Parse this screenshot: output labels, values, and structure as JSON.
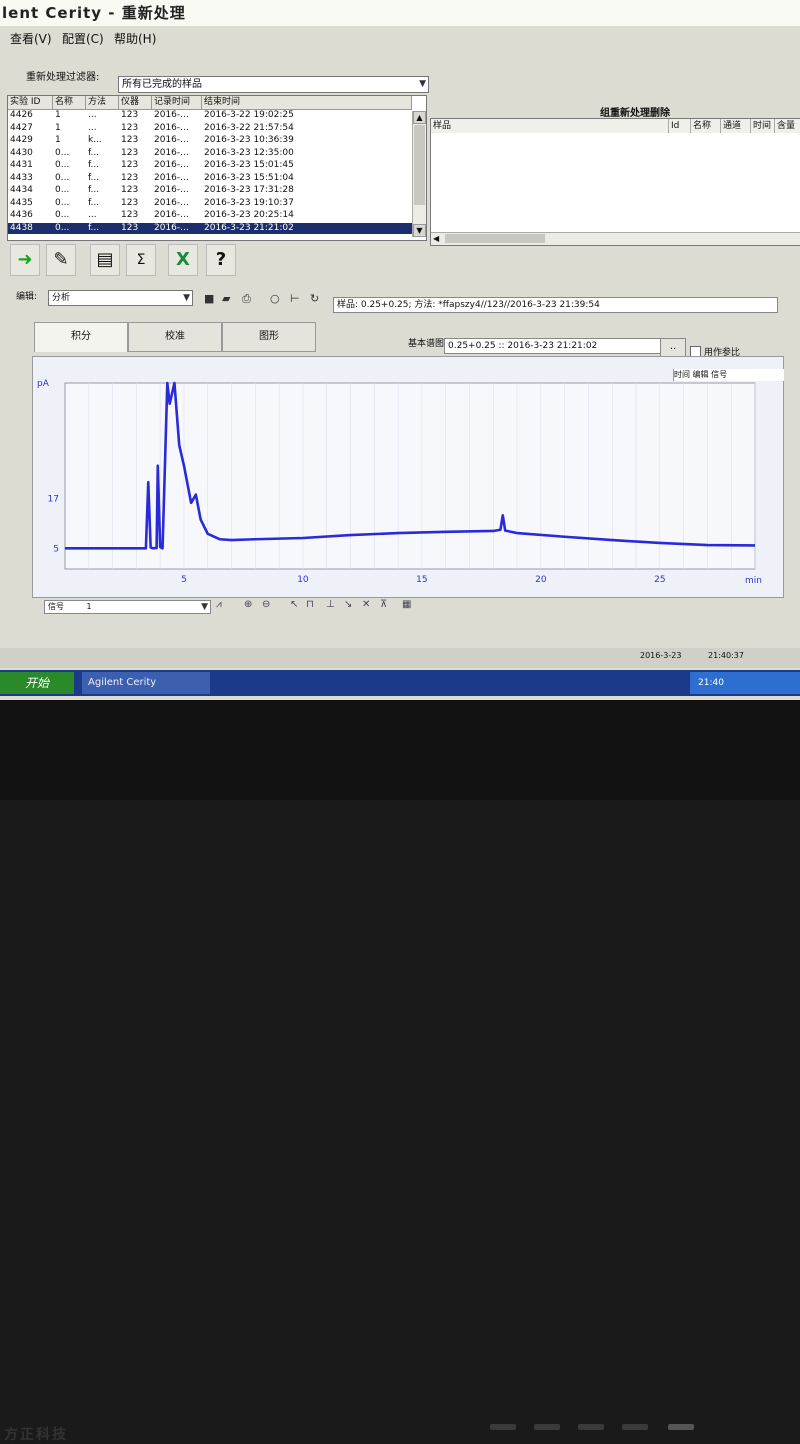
{
  "window": {
    "title": "lent Cerity - 重新处理"
  },
  "menu": [
    {
      "label": "查看(V)"
    },
    {
      "label": "配置(C)"
    },
    {
      "label": "帮助(H)"
    }
  ],
  "filter": {
    "label": "重新处理过滤器:",
    "value": "所有已完成的样品"
  },
  "samples_table": {
    "columns": [
      "实验 ID",
      "名称",
      "方法",
      "仪器",
      "记录时间",
      "结束时间"
    ],
    "rows": [
      [
        "4426",
        "1",
        "...",
        "123",
        "2016-...",
        "2016-3-22 19:02:25"
      ],
      [
        "4427",
        "1",
        "...",
        "123",
        "2016-...",
        "2016-3-22 21:57:54"
      ],
      [
        "4429",
        "1",
        "k...",
        "123",
        "2016-...",
        "2016-3-23 10:36:39"
      ],
      [
        "4430",
        "0...",
        "f...",
        "123",
        "2016-...",
        "2016-3-23 12:35:00"
      ],
      [
        "4431",
        "0...",
        "f...",
        "123",
        "2016-...",
        "2016-3-23 15:01:45"
      ],
      [
        "4433",
        "0...",
        "f...",
        "123",
        "2016-...",
        "2016-3-23 15:51:04"
      ],
      [
        "4434",
        "0...",
        "f...",
        "123",
        "2016-...",
        "2016-3-23 17:31:28"
      ],
      [
        "4435",
        "0...",
        "f...",
        "123",
        "2016-...",
        "2016-3-23 19:10:37"
      ],
      [
        "4436",
        "0...",
        "...",
        "123",
        "2016-...",
        "2016-3-23 20:25:14"
      ],
      [
        "4438",
        "0...",
        "f...",
        "123",
        "2016-...",
        "2016-3-23 21:21:02"
      ]
    ],
    "selected_index": 9
  },
  "reprocess": {
    "title": "组重新处理删除",
    "columns": [
      "样品",
      "Id",
      "名称",
      "通道",
      "时间",
      "含量"
    ]
  },
  "toolbar": {
    "icons": [
      "run-arrow-icon",
      "edit-notepad-icon",
      "table-grid-icon",
      "sum-report-icon",
      "excel-export-icon",
      "help-icon"
    ],
    "help_glyph": "?"
  },
  "edit": {
    "mode_label": "编辑:",
    "mode_value": "分析"
  },
  "sample_info": "样品: 0.25+0.25; 方法: *ffapszy4//123//2016-3-23 21:39:54",
  "tabs": [
    "积分",
    "校准",
    "图形"
  ],
  "base_chrom": {
    "label": "基本谱图",
    "value": "0.25+0.25 :: 2016-3-23 21:21:02",
    "ellipsis": "..",
    "overlay_label": "用作参比"
  },
  "chart_data": {
    "type": "line",
    "title": "",
    "ylabel": "pA",
    "xlabel": "min",
    "xlim": [
      0,
      29
    ],
    "ylim": [
      0,
      45
    ],
    "yticks": [
      5,
      17
    ],
    "xticks": [
      5,
      10,
      15,
      20,
      25
    ],
    "series": [
      {
        "values_xy": [
          [
            0,
            5.0
          ],
          [
            3.0,
            5.0
          ],
          [
            3.4,
            5.0
          ],
          [
            3.5,
            21.0
          ],
          [
            3.6,
            5.2
          ],
          [
            3.7,
            5.0
          ],
          [
            3.85,
            5.1
          ],
          [
            3.9,
            25.0
          ],
          [
            4.0,
            5.3
          ],
          [
            4.1,
            5.0
          ],
          [
            4.3,
            45
          ],
          [
            4.4,
            40
          ],
          [
            4.6,
            45
          ],
          [
            4.8,
            30
          ],
          [
            5.0,
            25
          ],
          [
            5.3,
            16
          ],
          [
            5.5,
            18
          ],
          [
            5.7,
            12
          ],
          [
            6.0,
            8.5
          ],
          [
            6.5,
            7.2
          ],
          [
            7,
            7.0
          ],
          [
            8,
            7.2
          ],
          [
            10,
            7.5
          ],
          [
            12,
            8.2
          ],
          [
            14,
            8.7
          ],
          [
            16,
            9.0
          ],
          [
            18.0,
            9.2
          ],
          [
            18.3,
            9.5
          ],
          [
            18.4,
            13.0
          ],
          [
            18.5,
            9.3
          ],
          [
            19,
            8.7
          ],
          [
            21,
            7.8
          ],
          [
            23,
            7.0
          ],
          [
            25,
            6.3
          ],
          [
            27,
            5.8
          ],
          [
            29,
            5.7
          ]
        ]
      }
    ],
    "legend_header": "时间 编辑 信号",
    "series_color": "#2a2ad8"
  },
  "plot_controls": {
    "signal_label": "信号",
    "signal_value": "1"
  },
  "statusbar": {
    "date": "2016-3-23",
    "time": "21:40:37"
  },
  "taskbar": {
    "start": "开始",
    "task": "Agilent Cerity",
    "tray_time": "21:40"
  },
  "bezel": {
    "brand": "方正科技"
  }
}
